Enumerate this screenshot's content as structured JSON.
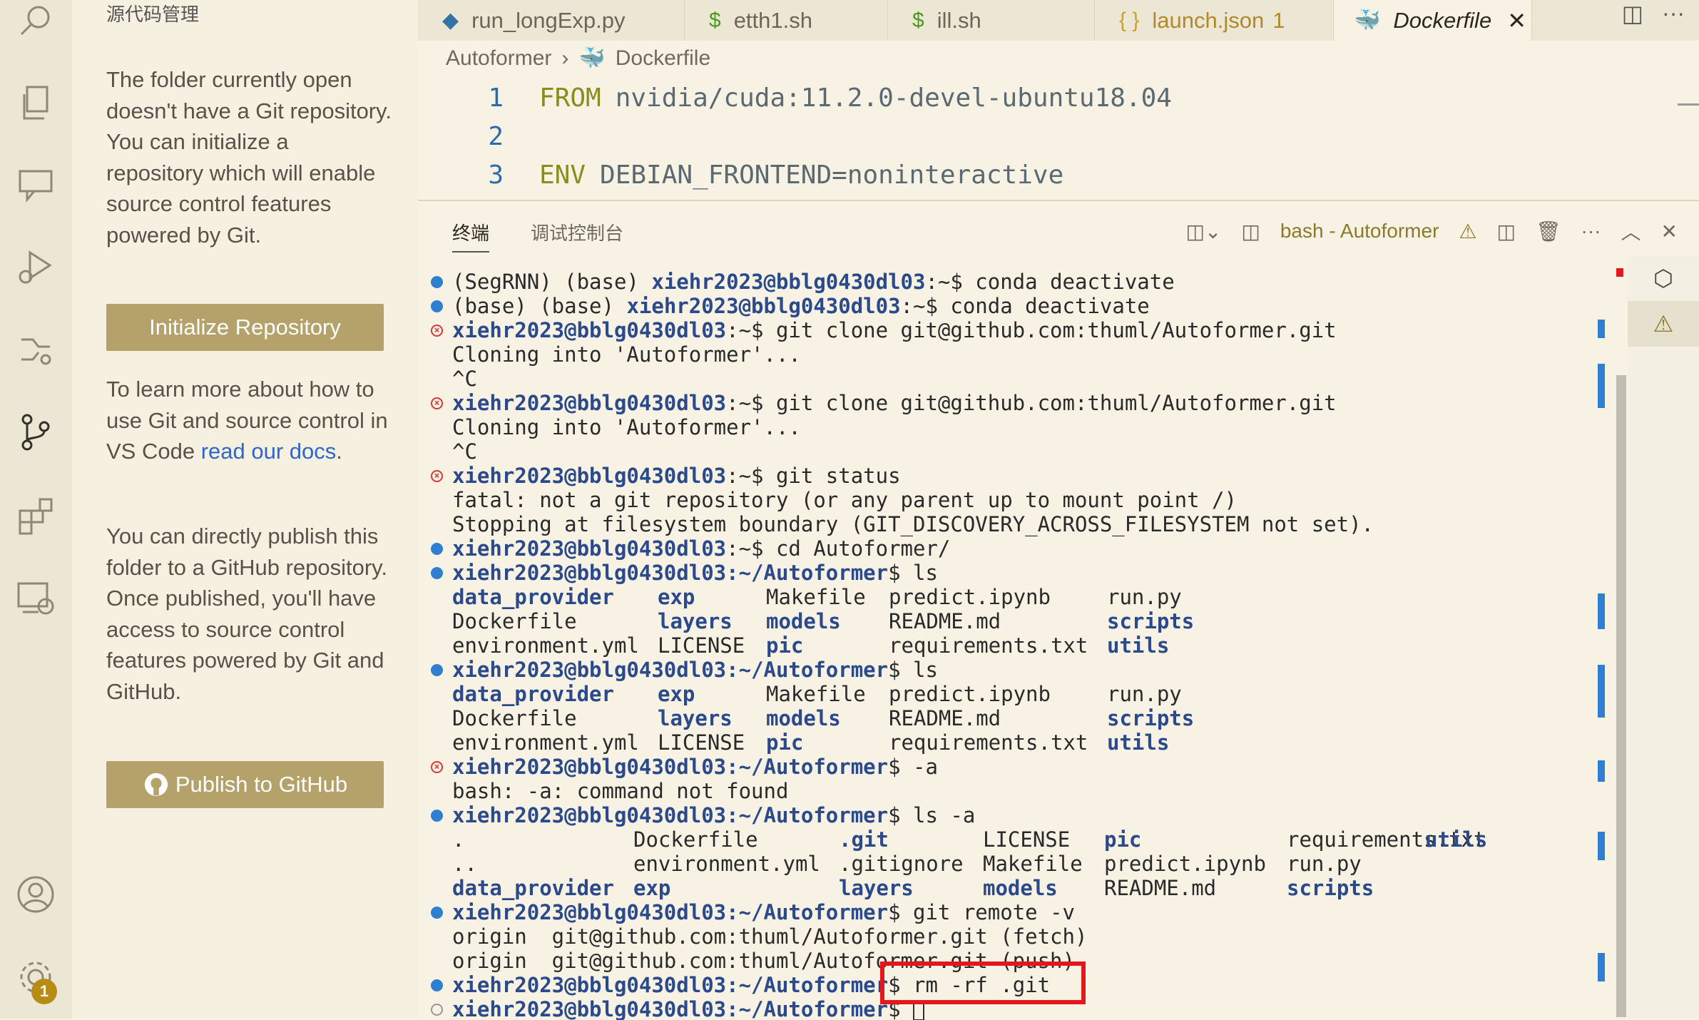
{
  "side_panel": {
    "title": "源代码管理",
    "intro": "The folder currently open doesn't have a Git repository. You can initialize a repository which will enable source control features powered by Git.",
    "init_button": "Initialize Repository",
    "learn_text": "To learn more about how to use Git and source control in VS Code ",
    "docs_link": "read our docs",
    "learn_suffix": ".",
    "publish_text": "You can directly publish this folder to a GitHub repository. Once published, you'll have access to source control features powered by Git and GitHub.",
    "publish_button": "Publish to GitHub"
  },
  "activity": {
    "settings_badge": "1"
  },
  "tabs": [
    {
      "label": "run_longExp.py",
      "icon": "python-icon"
    },
    {
      "label": "etth1.sh",
      "icon": "$"
    },
    {
      "label": "ill.sh",
      "icon": "$"
    },
    {
      "label": "launch.json",
      "icon": "{ }",
      "count": "1"
    },
    {
      "label": "Dockerfile",
      "icon": "docker-icon"
    }
  ],
  "breadcrumb": {
    "folder": "Autoformer",
    "file": "Dockerfile"
  },
  "editor": {
    "lines": [
      {
        "num": "1",
        "kw": "FROM",
        "rest": "nvidia/cuda:11.2.0-devel-ubuntu18.04"
      },
      {
        "num": "2",
        "kw": "",
        "rest": ""
      },
      {
        "num": "3",
        "kw": "ENV",
        "rest": "DEBIAN_FRONTEND=noninteractive"
      }
    ]
  },
  "panel": {
    "tab_terminal": "终端",
    "tab_debug": "调试控制台",
    "terminal_title": "bash - Autoformer"
  },
  "terminal": {
    "line1_a": "(SegRNN) (base) ",
    "line1_prompt": "xiehr2023@bblg0430dl03",
    "line1_b": ":~$ conda deactivate",
    "line2_a": "(base) (base) ",
    "line2_prompt": "xiehr2023@bblg0430dl03",
    "line2_b": ":~$ conda deactivate",
    "prompt_home": "xiehr2023@bblg0430dl03",
    "cmd_clone": ":~$ git clone git@github.com:thuml/Autoformer.git",
    "out_cloning": "Cloning into 'Autoformer'...",
    "out_ctrlc": "^C",
    "cmd_status": ":~$ git status",
    "out_fatal1": "fatal: not a git repository (or any parent up to mount point /)",
    "out_fatal2": "Stopping at filesystem boundary (GIT_DISCOVERY_ACROSS_FILESYSTEM not set).",
    "cmd_cd": ":~$ cd Autoformer/",
    "prompt_af": "xiehr2023@bblg0430dl03:~/Autoformer",
    "cmd_ls": "$ ls",
    "ls_r1_a": "data_provider",
    "ls_r1_b": "exp",
    "ls_r1_c": "Makefile",
    "ls_r1_d": "predict.ipynb",
    "ls_r1_e": "run.py",
    "ls_r2_a": "Dockerfile",
    "ls_r2_b": "layers",
    "ls_r2_c": "models",
    "ls_r2_d": "README.md",
    "ls_r2_e": "scripts",
    "ls_r3_a": "environment.yml",
    "ls_r3_b": "LICENSE",
    "ls_r3_c": "pic",
    "ls_r3_d": "requirements.txt",
    "ls_r3_e": "utils",
    "cmd_a": "$ -a",
    "out_notfound": "bash: -a: command not found",
    "cmd_lsa": "$ ls -a",
    "lsa_r1_a": ".",
    "lsa_r1_b": "Dockerfile",
    "lsa_r1_c": ".git",
    "lsa_r1_d": "LICENSE",
    "lsa_r1_e": "pic",
    "lsa_r1_f": "requirements.txt",
    "lsa_r1_g": "utils",
    "lsa_r2_a": "..",
    "lsa_r2_b": "environment.yml",
    "lsa_r2_c": ".gitignore",
    "lsa_r2_d": "Makefile",
    "lsa_r2_e": "predict.ipynb",
    "lsa_r2_f": "run.py",
    "lsa_r3_a": "data_provider",
    "lsa_r3_b": "exp",
    "lsa_r3_c": "layers",
    "lsa_r3_d": "models",
    "lsa_r3_e": "README.md",
    "lsa_r3_f": "scripts",
    "cmd_remote": "$ git remote -v",
    "out_fetch": "origin  git@github.com:thuml/Autoformer.git (fetch)",
    "out_push": "origin  git@github.com:thuml/Autoformer.git (push)",
    "cmd_rm": "$ rm -rf .git",
    "cmd_cursor": "$ "
  },
  "colors": {
    "highlight_box": "#e4171c",
    "button": "#b4a26a",
    "ok_dot": "#2f7fd1",
    "error_dot": "#d53a3a"
  }
}
